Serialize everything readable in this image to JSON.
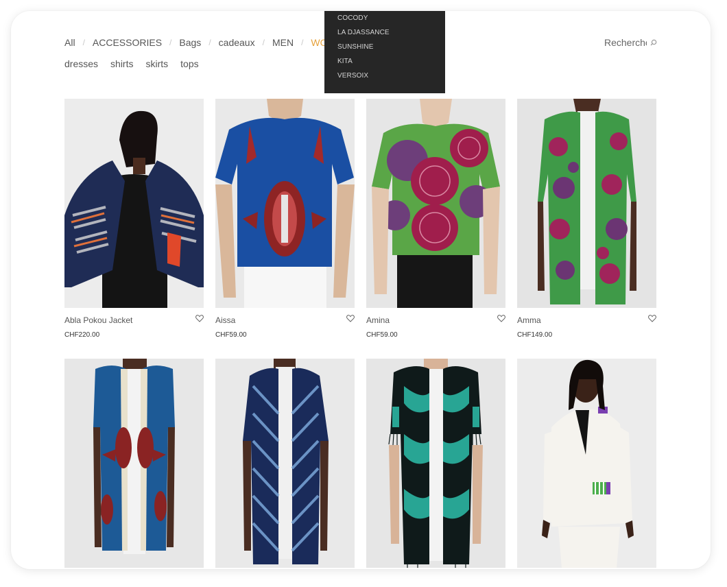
{
  "nav": {
    "categories": [
      "All",
      "ACCESSORIES",
      "Bags",
      "cadeaux",
      "MEN",
      "WOMEN"
    ],
    "active_category": "WOMEN",
    "subcategories": [
      "dresses",
      "shirts",
      "skirts",
      "tops"
    ]
  },
  "dropdown": {
    "items": [
      "COCODY",
      "LA DJASSANCE",
      "SUNSHINE",
      "KITA",
      "VERSOIX"
    ]
  },
  "search": {
    "placeholder": "Recherche",
    "icon": "search-icon"
  },
  "colors": {
    "accent": "#e6a23c",
    "dropdown_bg": "#262626",
    "text": "#555555"
  },
  "products": [
    {
      "name": "Abla Pokou Jacket",
      "price": "CHF220.00"
    },
    {
      "name": "Aissa",
      "price": "CHF59.00"
    },
    {
      "name": "Amina",
      "price": "CHF59.00"
    },
    {
      "name": "Amma",
      "price": "CHF149.00"
    },
    {
      "name": "",
      "price": ""
    },
    {
      "name": "",
      "price": ""
    },
    {
      "name": "",
      "price": ""
    },
    {
      "name": "",
      "price": ""
    }
  ]
}
